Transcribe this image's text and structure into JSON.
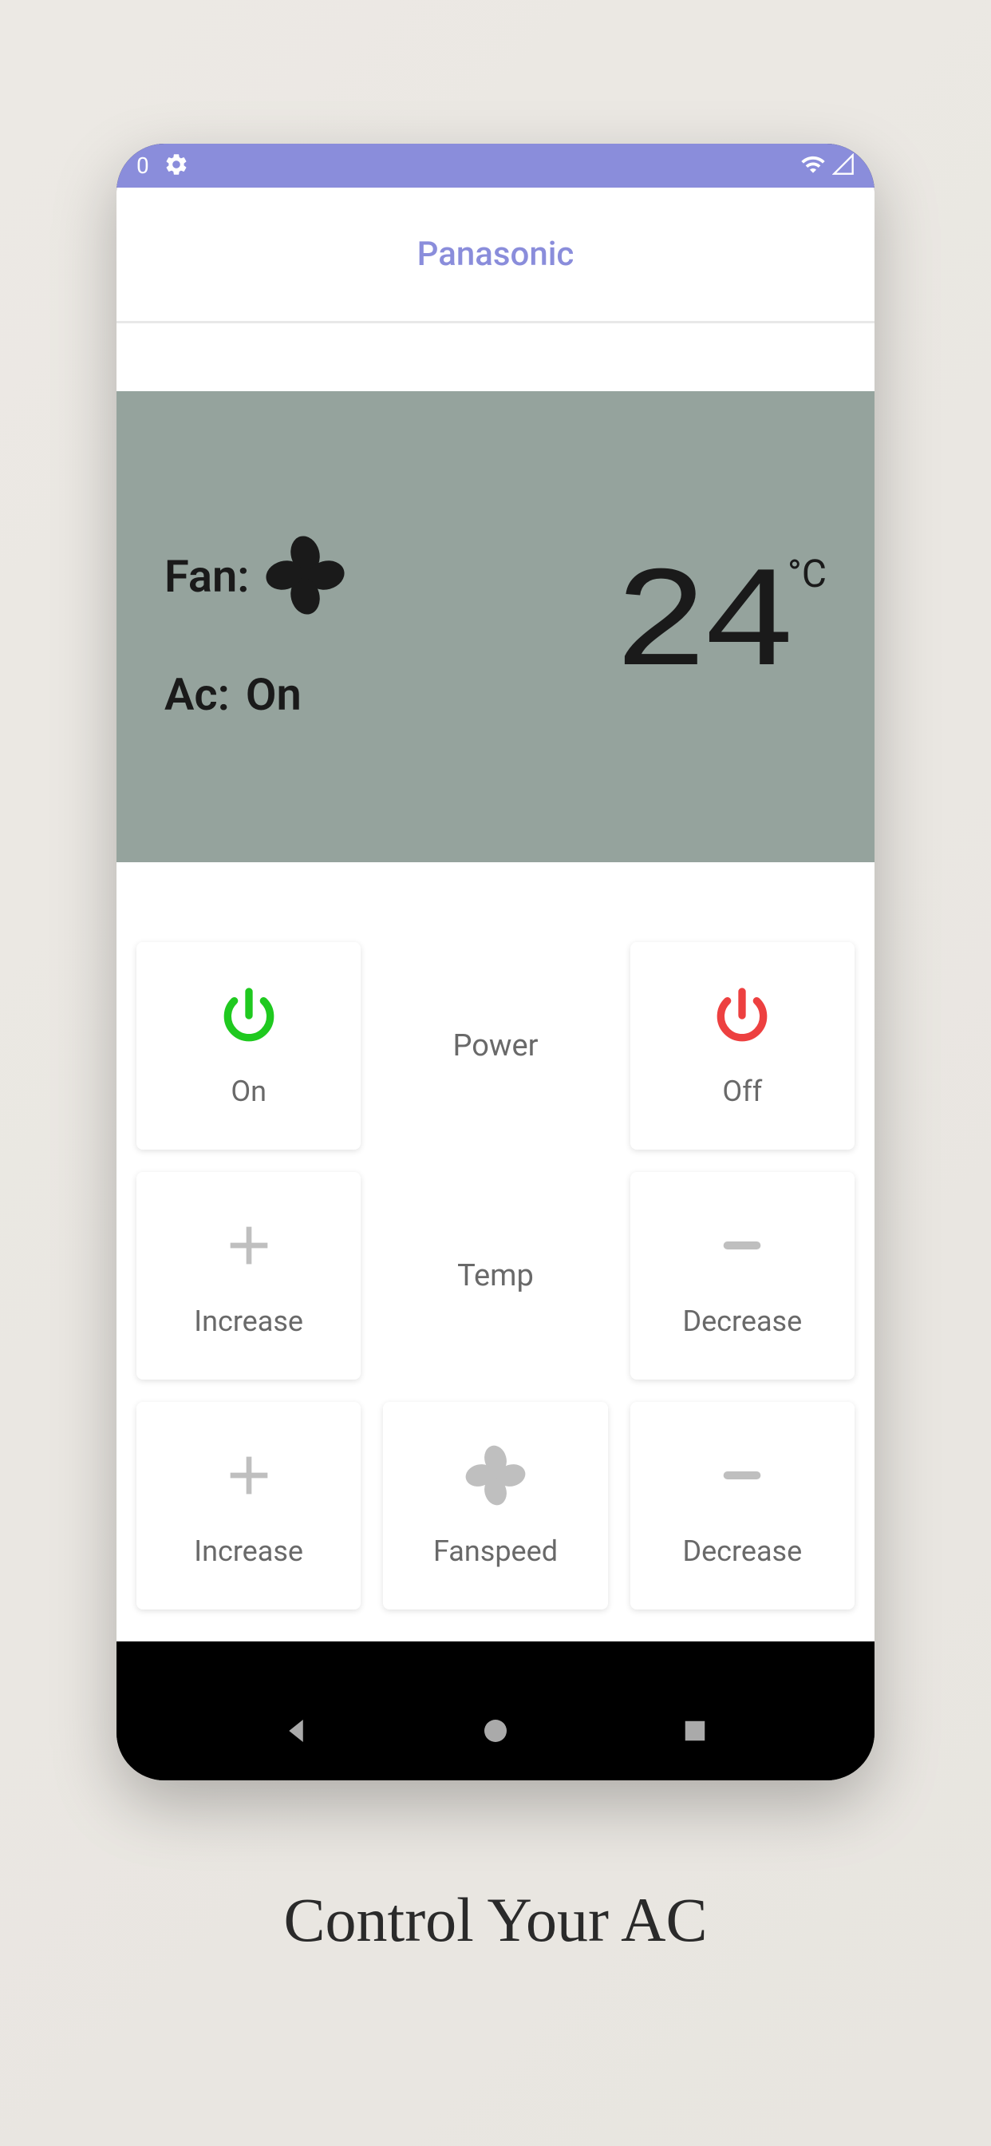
{
  "status_bar": {
    "partial_text": "0"
  },
  "header": {
    "title": "Panasonic"
  },
  "display": {
    "fan_label": "Fan:",
    "ac_label": "Ac:",
    "ac_status": "On",
    "temperature": "24",
    "temp_unit": "°C"
  },
  "controls": {
    "row1": {
      "left_label": "On",
      "center_label": "Power",
      "right_label": "Off"
    },
    "row2": {
      "left_label": "Increase",
      "center_label": "Temp",
      "right_label": "Decrease"
    },
    "row3": {
      "left_label": "Increase",
      "center_label": "Fanspeed",
      "right_label": "Decrease"
    }
  },
  "caption": "Control Your AC",
  "colors": {
    "accent": "#8a8ddb",
    "display_bg": "#95a39d",
    "on_green": "#1fc91f",
    "off_red": "#ed4040",
    "icon_gray": "#bfbfbf"
  }
}
